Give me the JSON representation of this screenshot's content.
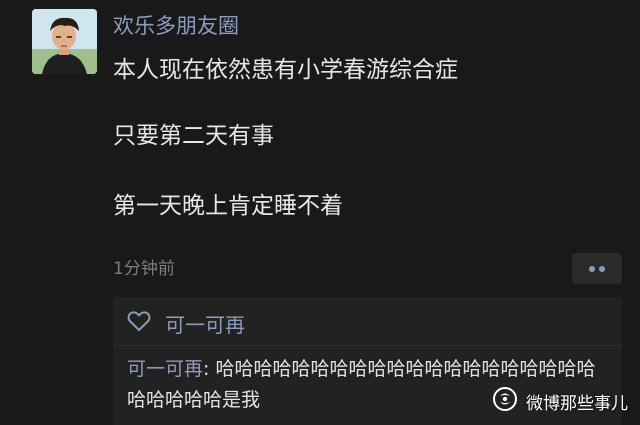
{
  "post": {
    "username": "欢乐多朋友圈",
    "lines": [
      "本人现在依然患有小学春游综合症",
      "只要第二天有事",
      "第一天晚上肯定睡不着"
    ],
    "timestamp": "1分钟前"
  },
  "interactions": {
    "likes": [
      "可一可再"
    ],
    "comments": [
      {
        "author": "可一可再",
        "separator": ": ",
        "text": "哈哈哈哈哈哈哈哈哈哈哈哈哈哈哈哈哈哈哈哈哈哈哈哈哈是我"
      }
    ]
  },
  "watermark": {
    "text": "微博那些事儿"
  },
  "icons": {
    "like": "heart-outline-icon",
    "more": "two-dots-icon",
    "watermark": "wechat-official-account-icon"
  },
  "colors": {
    "background": "#191919",
    "accent_name": "#8c9cbe",
    "text": "#e7e7e7",
    "muted": "#7d7d7d",
    "panel": "#222222"
  }
}
